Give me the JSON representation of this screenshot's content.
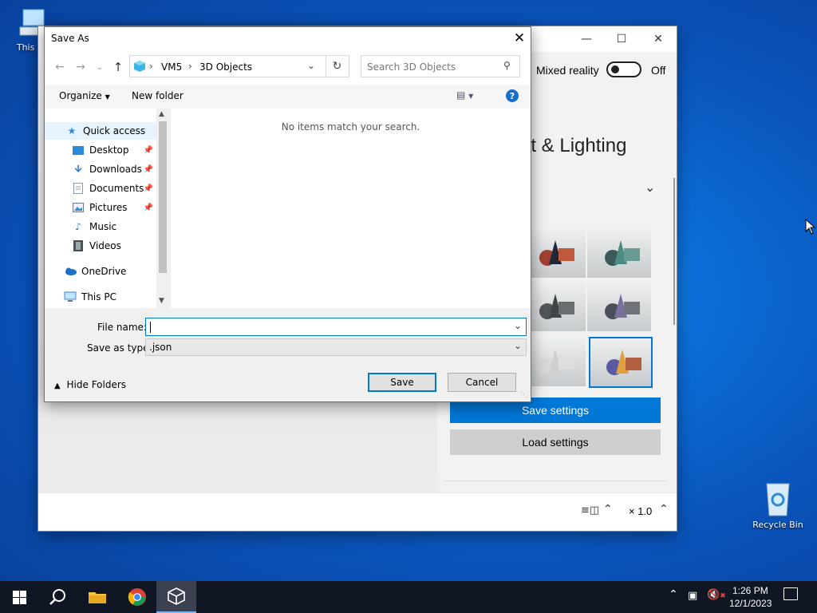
{
  "desktop": {
    "this_pc_label": "This PC",
    "recycle_bin_label": "Recycle Bin"
  },
  "viewer": {
    "mixed_reality_label": "Mixed reality",
    "mixed_reality_state": "Off",
    "section_title": "nt & Lighting",
    "save_settings": "Save settings",
    "load_settings": "Load settings",
    "zoom": "× 1.0",
    "accent": "#0078d7"
  },
  "dialog": {
    "title": "Save As",
    "breadcrumb": [
      "VM5",
      "3D Objects"
    ],
    "search_placeholder": "Search 3D Objects",
    "organize": "Organize",
    "new_folder": "New folder",
    "empty_message": "No items match your search.",
    "nav": [
      {
        "label": "Quick access",
        "icon": "star-icon"
      },
      {
        "label": "Desktop",
        "icon": "desktop-folder-icon",
        "pinned": true
      },
      {
        "label": "Downloads",
        "icon": "download-arrow-icon",
        "pinned": true
      },
      {
        "label": "Documents",
        "icon": "document-icon",
        "pinned": true
      },
      {
        "label": "Pictures",
        "icon": "pictures-icon",
        "pinned": true
      },
      {
        "label": "Music",
        "icon": "music-note-icon"
      },
      {
        "label": "Videos",
        "icon": "film-icon"
      },
      {
        "label": "OneDrive",
        "icon": "cloud-icon"
      },
      {
        "label": "This PC",
        "icon": "computer-icon"
      }
    ],
    "file_name_label": "File name:",
    "file_name_value": "",
    "save_type_label": "Save as type:",
    "save_type_value": ".json",
    "hide_folders": "Hide Folders",
    "save": "Save",
    "cancel": "Cancel"
  },
  "taskbar": {
    "time": "1:26 PM",
    "date": "12/1/2023"
  }
}
